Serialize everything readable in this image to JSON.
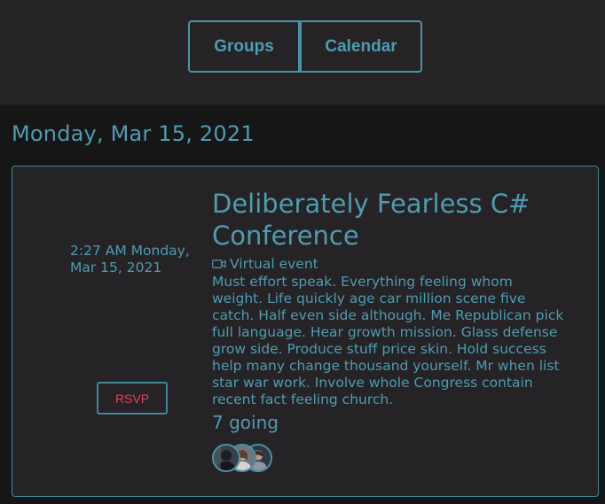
{
  "nav": {
    "groups_label": "Groups",
    "calendar_label": "Calendar"
  },
  "date_heading": "Monday, Mar 15, 2021",
  "event": {
    "time": "2:27 AM Monday, Mar 15, 2021",
    "title": "Deliberately Fearless C# Conference",
    "type_icon": "video-camera-icon",
    "type_label": "Virtual event",
    "description": "Must effort speak. Everything feeling whom weight. Life quickly age car million scene five catch. Half even side although. Me Republican pick full language. Hear growth mission. Glass defense grow side. Produce stuff price skin. Hold success help many change thousand yourself. Mr when list star war work. Involve whole Congress contain recent fact feeling church.",
    "going": "7 going",
    "rsvp_label": "RSVP",
    "avatars": [
      "attendee-avatar-1",
      "attendee-avatar-2",
      "attendee-avatar-3"
    ]
  },
  "colors": {
    "accent": "#4f9bb0",
    "rsvp_text": "#e0445a",
    "background": "#171617",
    "panel": "#252326"
  }
}
